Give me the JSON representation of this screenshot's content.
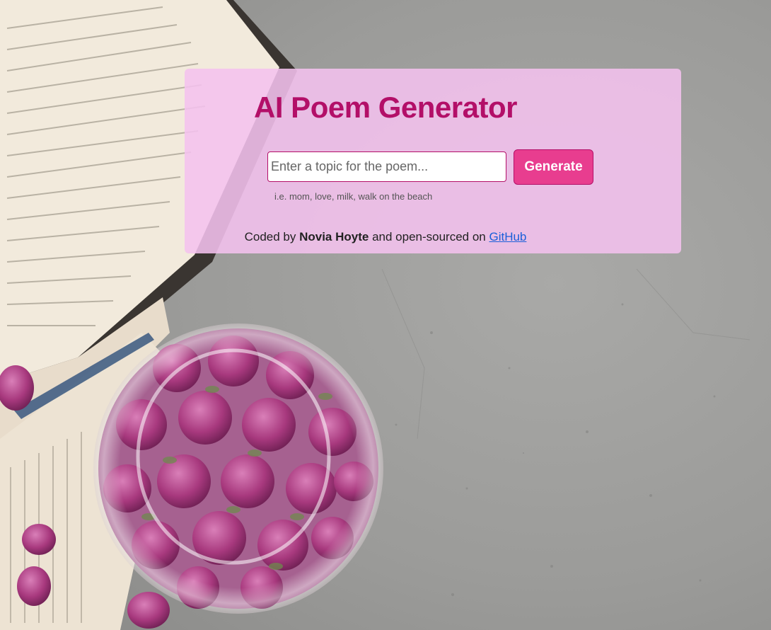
{
  "app": {
    "title": "AI Poem Generator"
  },
  "form": {
    "input_placeholder": "Enter a topic for the poem...",
    "input_value": "",
    "generate_label": "Generate",
    "hint": "i.e. mom, love, milk, walk on the beach"
  },
  "footer": {
    "prefix": "Coded by ",
    "author": "Novia Hoyte",
    "middle": " and open-sourced on ",
    "link_label": "GitHub"
  },
  "theme": {
    "accent": "#b30f68",
    "button": "#e83d8f",
    "card": "#f4c1ee",
    "link": "#1a5fd9"
  }
}
